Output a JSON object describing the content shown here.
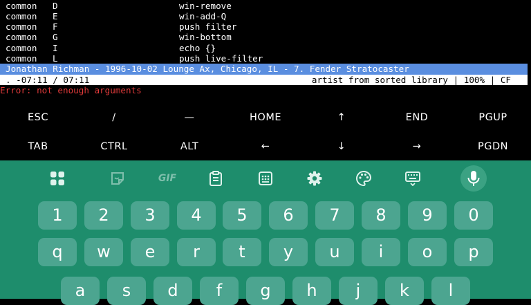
{
  "terminal": {
    "bindings": [
      {
        "mode": "common",
        "key": "D",
        "command": "win-remove"
      },
      {
        "mode": "common",
        "key": "E",
        "command": "win-add-Q"
      },
      {
        "mode": "common",
        "key": "F",
        "command": "push filter"
      },
      {
        "mode": "common",
        "key": "G",
        "command": "win-bottom"
      },
      {
        "mode": "common",
        "key": "I",
        "command": "echo {}"
      },
      {
        "mode": "common",
        "key": "L",
        "command": "push live-filter"
      }
    ],
    "now_playing": "Jonathan Richman - 1996-10-02 Lounge Ax, Chicago, IL - 7. Fender Stratocaster",
    "status_left": ". -07:11 / 07:11",
    "status_right": "artist from sorted library | 100% | CF",
    "error": "Error: not enough arguments",
    "colors": {
      "highlight": "#5a8ee0",
      "error": "#e03a3a"
    }
  },
  "extra_keys": {
    "row1": [
      "ESC",
      "/",
      "—",
      "HOME",
      "↑",
      "END",
      "PGUP"
    ],
    "row2": [
      "TAB",
      "CTRL",
      "ALT",
      "←",
      "↓",
      "→",
      "PGDN"
    ]
  },
  "keyboard": {
    "toolbar": [
      "apps-grid-icon",
      "sticker-icon",
      "gif-icon",
      "clipboard-icon",
      "calculator-icon",
      "gear-icon",
      "palette-icon",
      "keyboard-icon",
      "microphone-icon"
    ],
    "gif_label": "GIF",
    "digits": [
      "1",
      "2",
      "3",
      "4",
      "5",
      "6",
      "7",
      "8",
      "9",
      "0"
    ],
    "row_qwerty": [
      "q",
      "w",
      "e",
      "r",
      "t",
      "y",
      "u",
      "i",
      "o",
      "p"
    ],
    "row_asdf": [
      "a",
      "s",
      "d",
      "f",
      "g",
      "h",
      "j",
      "k",
      "l"
    ],
    "colors": {
      "background": "#1e8d6c",
      "key": "#4ca590"
    }
  }
}
